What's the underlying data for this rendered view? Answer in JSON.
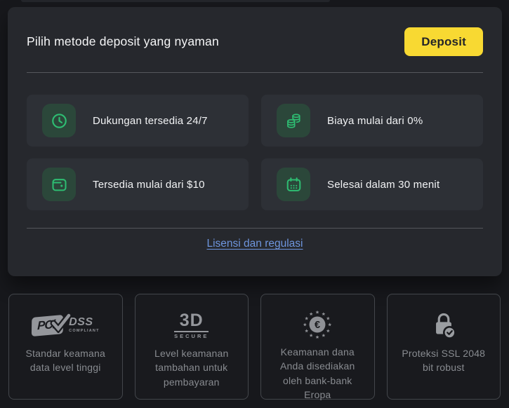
{
  "card": {
    "title": "Pilih metode deposit yang nyaman",
    "deposit_button": "Deposit",
    "features": [
      {
        "icon": "clock-icon",
        "label": "Dukungan tersedia 24/7"
      },
      {
        "icon": "coins-icon",
        "label": "Biaya mulai dari 0%"
      },
      {
        "icon": "wallet-icon",
        "label": "Tersedia mulai dari $10"
      },
      {
        "icon": "calendar-icon",
        "label": "Selesai dalam 30 menit"
      }
    ],
    "license_link": "Lisensi dan regulasi"
  },
  "badges": {
    "items": [
      {
        "logo": {
          "pci": "PCi",
          "dss": "DSS",
          "compliant": "COMPLIANT"
        },
        "caption": "Standar keamana data level tinggi"
      },
      {
        "logo": {
          "td": "3D",
          "secure": "SECURE"
        },
        "caption": "Level keamanan tambahan untuk pembayaran"
      },
      {
        "icon_symbol": "€",
        "caption": "Keamanan dana Anda disediakan oleh bank-bank Eropa"
      },
      {
        "caption": "Proteksi SSL 2048 bit robust"
      }
    ]
  },
  "colors": {
    "accent_yellow": "#f8d932",
    "accent_green": "#2ebd72",
    "link_blue": "#6e95de",
    "card_bg": "#26282d",
    "page_bg": "#17181c"
  }
}
